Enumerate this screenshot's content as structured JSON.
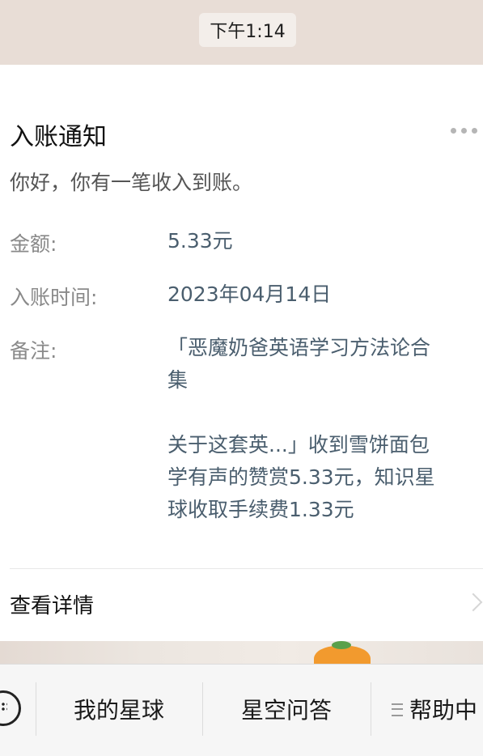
{
  "status": {
    "time": "下午1:14"
  },
  "notice": {
    "title": "入账通知",
    "greeting": "你好，你有一笔收入到账。",
    "rows": [
      {
        "label": "金额:",
        "value": "5.33元"
      },
      {
        "label": "入账时间:",
        "value": "2023年04月14日"
      },
      {
        "label": "备注:",
        "value_lines": [
          "「恶魔奶爸英语学习方法论合",
          "集",
          "",
          "关于这套英...」收到雪饼面包",
          "学有声的赞赏5.33元，知识星",
          "球收取手续费1.33元"
        ]
      }
    ],
    "detail_label": "查看详情"
  },
  "bottom_bar": {
    "tabs": [
      "我的星球",
      "星空问答",
      "帮助中"
    ]
  },
  "icons": {
    "more": "more-icon",
    "chevron": "chevron-right-icon",
    "keyboard": "keyboard-icon",
    "menu": "menu-icon"
  }
}
